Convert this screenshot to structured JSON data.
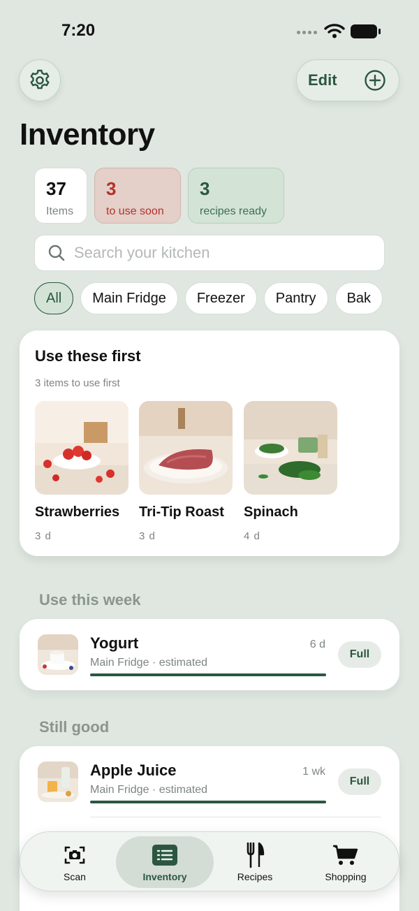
{
  "status_bar": {
    "time": "7:20"
  },
  "header": {
    "edit_label": "Edit",
    "title": "Inventory"
  },
  "stats": [
    {
      "value": "37",
      "label": "Items"
    },
    {
      "value": "3",
      "label": "to use soon"
    },
    {
      "value": "3",
      "label": "recipes ready"
    }
  ],
  "search": {
    "placeholder": "Search your kitchen"
  },
  "filters": [
    "All",
    "Main Fridge",
    "Freezer",
    "Pantry",
    "Bak"
  ],
  "use_first": {
    "title": "Use these first",
    "subtitle": "3 items to use first",
    "items": [
      {
        "name": "Strawberries",
        "days": "3 d"
      },
      {
        "name": "Tri-Tip Roast",
        "days": "3 d"
      },
      {
        "name": "Spinach",
        "days": "4 d"
      }
    ]
  },
  "sections": [
    {
      "label": "Use this week",
      "items": [
        {
          "name": "Yogurt",
          "meta": "Main Fridge · estimated",
          "days": "6 d",
          "action": "Full",
          "level": 1.0
        }
      ]
    },
    {
      "label": "Still good",
      "items": [
        {
          "name": "Apple Juice",
          "meta": "Main Fridge · estimated",
          "days": "1 wk",
          "action": "Full",
          "level": 1.0
        }
      ]
    }
  ],
  "tab_bar": {
    "tabs": [
      {
        "label": "Scan",
        "icon": "camera-icon"
      },
      {
        "label": "Inventory",
        "icon": "list-icon",
        "active": true
      },
      {
        "label": "Recipes",
        "icon": "fork-knife-icon"
      },
      {
        "label": "Shopping",
        "icon": "cart-icon"
      }
    ]
  },
  "colors": {
    "accent": "#2b5740",
    "warning": "#b2332a",
    "background": "#dfe7e0"
  }
}
